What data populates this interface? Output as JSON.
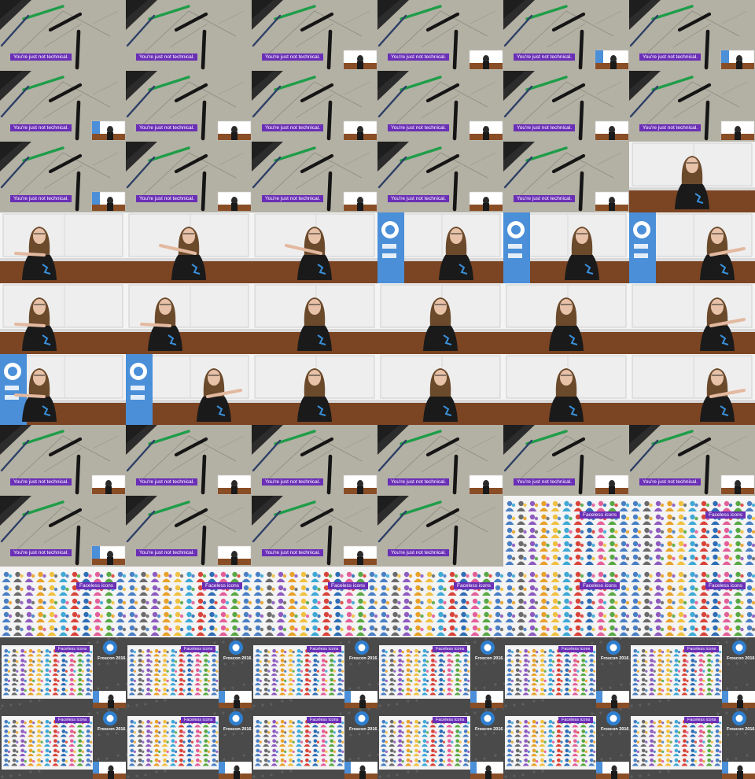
{
  "caption_desk": "You're just not technical.",
  "caption_icons": "Faceless icons",
  "event_label": "Froscon 2016",
  "colors": {
    "caption_bg": "#6a2fb6",
    "desk": "#b3b0a4",
    "wall": "#eeeeee",
    "wood": "#8a4e26",
    "banner": "#4a8fd8",
    "shirt": "#1a1a1a",
    "hair": "#6b4a2c",
    "conference_bg": "#4a4a4a"
  },
  "layout": {
    "columns": 6,
    "rows": 11
  },
  "frames": [
    {
      "type": "desk",
      "pip": "none"
    },
    {
      "type": "desk",
      "pip": "none"
    },
    {
      "type": "desk",
      "pip": "room"
    },
    {
      "type": "desk",
      "pip": "room"
    },
    {
      "type": "desk",
      "pip": "banner"
    },
    {
      "type": "desk",
      "pip": "banner"
    },
    {
      "type": "desk",
      "pip": "banner"
    },
    {
      "type": "desk",
      "pip": "room"
    },
    {
      "type": "desk",
      "pip": "room"
    },
    {
      "type": "desk",
      "pip": "room"
    },
    {
      "type": "desk",
      "pip": "room"
    },
    {
      "type": "desk",
      "pip": "room"
    },
    {
      "type": "desk",
      "pip": "banner"
    },
    {
      "type": "desk",
      "pip": "room"
    },
    {
      "type": "desk",
      "pip": "room"
    },
    {
      "type": "desk",
      "pip": "room"
    },
    {
      "type": "desk",
      "pip": "room"
    },
    {
      "type": "speaker",
      "banner": "none",
      "pose": "center"
    },
    {
      "type": "speaker",
      "banner": "none",
      "pose": "left"
    },
    {
      "type": "speaker",
      "banner": "none",
      "pose": "pointing"
    },
    {
      "type": "speaker",
      "banner": "none",
      "pose": "pointing"
    },
    {
      "type": "speaker",
      "banner": "left",
      "pose": "center"
    },
    {
      "type": "speaker",
      "banner": "left",
      "pose": "center"
    },
    {
      "type": "speaker",
      "banner": "left",
      "pose": "right"
    },
    {
      "type": "speaker",
      "banner": "none",
      "pose": "left"
    },
    {
      "type": "speaker",
      "banner": "none",
      "pose": "left"
    },
    {
      "type": "speaker",
      "banner": "none",
      "pose": "center"
    },
    {
      "type": "speaker",
      "banner": "none",
      "pose": "center"
    },
    {
      "type": "speaker",
      "banner": "none",
      "pose": "center"
    },
    {
      "type": "speaker",
      "banner": "none",
      "pose": "right"
    },
    {
      "type": "speaker",
      "banner": "left",
      "pose": "left"
    },
    {
      "type": "speaker",
      "banner": "left",
      "pose": "right"
    },
    {
      "type": "speaker",
      "banner": "none",
      "pose": "center"
    },
    {
      "type": "speaker",
      "banner": "none",
      "pose": "center"
    },
    {
      "type": "speaker",
      "banner": "none",
      "pose": "center"
    },
    {
      "type": "speaker",
      "banner": "none",
      "pose": "right"
    },
    {
      "type": "desk",
      "pip": "room"
    },
    {
      "type": "desk",
      "pip": "room"
    },
    {
      "type": "desk",
      "pip": "room"
    },
    {
      "type": "desk",
      "pip": "room"
    },
    {
      "type": "desk",
      "pip": "room"
    },
    {
      "type": "desk",
      "pip": "room"
    },
    {
      "type": "desk",
      "pip": "banner"
    },
    {
      "type": "desk",
      "pip": "room"
    },
    {
      "type": "desk",
      "pip": "room"
    },
    {
      "type": "desk",
      "pip": "none"
    },
    {
      "type": "icons"
    },
    {
      "type": "icons"
    },
    {
      "type": "icons"
    },
    {
      "type": "icons"
    },
    {
      "type": "icons"
    },
    {
      "type": "icons"
    },
    {
      "type": "icons"
    },
    {
      "type": "icons"
    },
    {
      "type": "conference"
    },
    {
      "type": "conference"
    },
    {
      "type": "conference"
    },
    {
      "type": "conference"
    },
    {
      "type": "conference"
    },
    {
      "type": "conference"
    },
    {
      "type": "conference"
    },
    {
      "type": "conference"
    },
    {
      "type": "conference"
    },
    {
      "type": "conference"
    },
    {
      "type": "conference"
    },
    {
      "type": "conference"
    }
  ]
}
